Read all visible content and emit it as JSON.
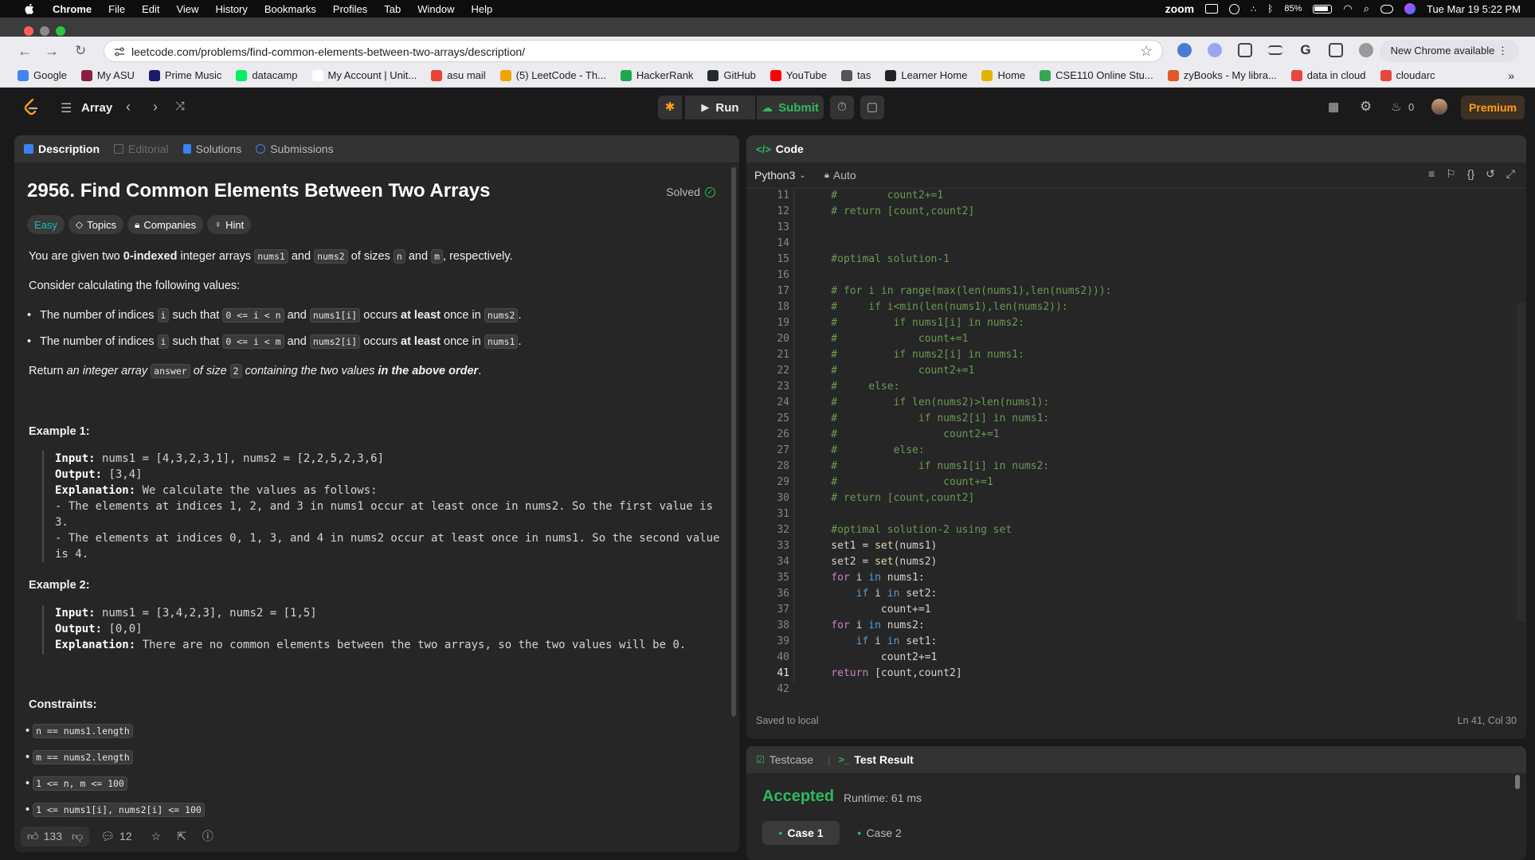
{
  "macbar": {
    "app": "Chrome",
    "menus": [
      "File",
      "Edit",
      "View",
      "History",
      "Bookmarks",
      "Profiles",
      "Tab",
      "Window",
      "Help"
    ],
    "zoom": "zoom",
    "battery": "85%",
    "datetime": "Tue Mar 19  5:22 PM"
  },
  "browser": {
    "url": "leetcode.com/problems/find-common-elements-between-two-arrays/description/",
    "new_chrome": "New Chrome available",
    "bookmarks": [
      {
        "label": "Google",
        "color": "#4285f4"
      },
      {
        "label": "My ASU",
        "color": "#8c1d40"
      },
      {
        "label": "Prime Music",
        "color": "#1a1a6e"
      },
      {
        "label": "datacamp",
        "color": "#03ef62"
      },
      {
        "label": "My Account | Unit...",
        "color": "#ffffff"
      },
      {
        "label": "asu mail",
        "color": "#ea4335"
      },
      {
        "label": "(5) LeetCode - Th...",
        "color": "#f0a500"
      },
      {
        "label": "HackerRank",
        "color": "#1ba94c"
      },
      {
        "label": "GitHub",
        "color": "#24292e"
      },
      {
        "label": "YouTube",
        "color": "#ff0000"
      },
      {
        "label": "tas",
        "color": "#555555"
      },
      {
        "label": "Learner Home",
        "color": "#222222"
      },
      {
        "label": "Home",
        "color": "#e3b400"
      },
      {
        "label": "CSE110 Online Stu...",
        "color": "#34a853"
      },
      {
        "label": "zyBooks - My libra...",
        "color": "#e05a2a"
      },
      {
        "label": "data in cloud",
        "color": "#e8453c"
      },
      {
        "label": "cloudarc",
        "color": "#e8453c"
      }
    ]
  },
  "lc_header": {
    "list_name": "Array",
    "run": "Run",
    "submit": "Submit",
    "streak": "0",
    "premium": "Premium"
  },
  "left_panel": {
    "tabs": [
      "Description",
      "Editorial",
      "Solutions",
      "Submissions"
    ],
    "title": "2956. Find Common Elements Between Two Arrays",
    "solved": "Solved",
    "chips": [
      "Easy",
      "Topics",
      "Companies",
      "Hint"
    ],
    "p1": [
      "You are given two ",
      "0-indexed",
      " integer arrays ",
      "nums1",
      " and ",
      "nums2",
      " of sizes ",
      "n",
      " and ",
      "m",
      ", respectively."
    ],
    "p2": "Consider calculating the following values:",
    "b1": [
      "The number of indices ",
      "i",
      " such that ",
      "0 <= i < n",
      " and ",
      "nums1[i]",
      " occurs ",
      "at least",
      " once in ",
      "nums2",
      "."
    ],
    "b2": [
      "The number of indices ",
      "i",
      " such that ",
      "0 <= i < m",
      " and ",
      "nums2[i]",
      " occurs ",
      "at least",
      " once in ",
      "nums1",
      "."
    ],
    "p3": [
      "Return ",
      "an integer array ",
      "answer",
      " of size ",
      "2",
      " containing the two values ",
      "in the above order",
      "."
    ],
    "ex1_title": "Example 1:",
    "ex1_input_label": "Input:",
    "ex1_input": " nums1 = [4,3,2,3,1], nums2 = [2,2,5,2,3,6]",
    "ex1_output_label": "Output:",
    "ex1_output": " [3,4]",
    "ex1_expl_label": "Explanation:",
    "ex1_expl": " We calculate the values as follows:",
    "ex1_l1": "- The elements at indices 1, 2, and 3 in nums1 occur at least once in nums2. So the first value is",
    "ex1_l2": "3.",
    "ex1_l3": "- The elements at indices 0, 1, 3, and 4 in nums2 occur at least once in nums1. So the second value",
    "ex1_l4": "is 4.",
    "ex2_title": "Example 2:",
    "ex2_input_label": "Input:",
    "ex2_input": " nums1 = [3,4,2,3], nums2 = [1,5]",
    "ex2_output_label": "Output:",
    "ex2_output": " [0,0]",
    "ex2_expl_label": "Explanation:",
    "ex2_expl": " There are no common elements between the two arrays, so the two values will be 0.",
    "constraints_title": "Constraints:",
    "constraints": [
      "n == nums1.length",
      "m == nums2.length",
      "1 <= n, m <= 100",
      "1 <= nums1[i], nums2[i] <= 100"
    ],
    "likes": "133",
    "comments": "12"
  },
  "code_panel": {
    "tab": "Code",
    "language": "Python3",
    "mode": "Auto",
    "lines": [
      {
        "n": "11",
        "t": "    #        count2+=1",
        "c": "comment"
      },
      {
        "n": "12",
        "t": "    # return [count,count2]",
        "c": "comment"
      },
      {
        "n": "13",
        "t": "",
        "c": "plain"
      },
      {
        "n": "14",
        "t": "",
        "c": "plain"
      },
      {
        "n": "15",
        "t": "    #optimal solution-1",
        "c": "comment"
      },
      {
        "n": "16",
        "t": "",
        "c": "plain"
      },
      {
        "n": "17",
        "t": "    # for i in range(max(len(nums1),len(nums2))):",
        "c": "comment"
      },
      {
        "n": "18",
        "t": "    #     if i<min(len(nums1),len(nums2)):",
        "c": "comment"
      },
      {
        "n": "19",
        "t": "    #         if nums1[i] in nums2:",
        "c": "comment"
      },
      {
        "n": "20",
        "t": "    #             count+=1",
        "c": "comment"
      },
      {
        "n": "21",
        "t": "    #         if nums2[i] in nums1:",
        "c": "comment"
      },
      {
        "n": "22",
        "t": "    #             count2+=1",
        "c": "comment"
      },
      {
        "n": "23",
        "t": "    #     else:",
        "c": "comment"
      },
      {
        "n": "24",
        "t": "    #         if len(nums2)>len(nums1):",
        "c": "comment"
      },
      {
        "n": "25",
        "t": "    #             if nums2[i] in nums1:",
        "c": "comment"
      },
      {
        "n": "26",
        "t": "    #                 count2+=1",
        "c": "comment"
      },
      {
        "n": "27",
        "t": "    #         else:",
        "c": "comment"
      },
      {
        "n": "28",
        "t": "    #             if nums1[i] in nums2:",
        "c": "comment"
      },
      {
        "n": "29",
        "t": "    #                 count+=1",
        "c": "comment"
      },
      {
        "n": "30",
        "t": "    # return [count,count2]",
        "c": "comment"
      },
      {
        "n": "31",
        "t": "",
        "c": "plain"
      },
      {
        "n": "32",
        "t": "    #optimal solution-2 using set",
        "c": "comment"
      },
      {
        "n": "33",
        "t": "    set1 = set(nums1)",
        "c": "plain"
      },
      {
        "n": "34",
        "t": "    set2 = set(nums2)",
        "c": "plain"
      },
      {
        "n": "35",
        "t": "    for i in nums1:",
        "c": "plain"
      },
      {
        "n": "36",
        "t": "        if i in set2:",
        "c": "plain"
      },
      {
        "n": "37",
        "t": "            count+=1",
        "c": "plain"
      },
      {
        "n": "38",
        "t": "    for i in nums2:",
        "c": "plain"
      },
      {
        "n": "39",
        "t": "        if i in set1:",
        "c": "plain"
      },
      {
        "n": "40",
        "t": "            count2+=1",
        "c": "plain"
      },
      {
        "n": "41",
        "t": "    return [count,count2]",
        "c": "plain"
      },
      {
        "n": "42",
        "t": "",
        "c": "plain"
      }
    ],
    "saved": "Saved to local",
    "cursor": "Ln 41, Col 30"
  },
  "result_panel": {
    "tab1": "Testcase",
    "tab2": "Test Result",
    "status": "Accepted",
    "runtime": "Runtime: 61 ms",
    "case1": "Case 1",
    "case2": "Case 2"
  }
}
